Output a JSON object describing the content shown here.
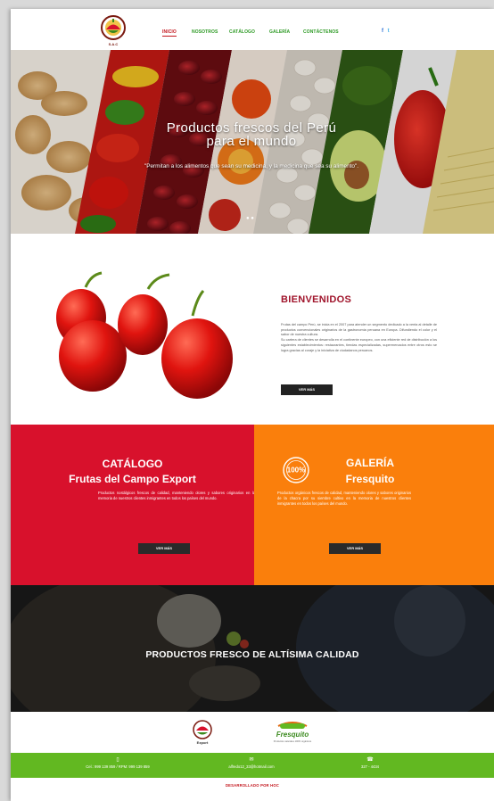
{
  "header": {
    "logo_text": "Frutas del Campo Perú",
    "logo_sub": "S.A.C",
    "nav": [
      "INICIO",
      "NOSOTROS",
      "CATÁLOGO",
      "GALERÍA",
      "CONTÁCTENOS"
    ],
    "active_nav": "INICIO",
    "social": [
      "f",
      "t"
    ]
  },
  "hero": {
    "title_line1": "Productos frescos del Perú",
    "title_line2": "para el mundo",
    "quote": "\"Permitan a los alimentos que sean su medicina, y la medicina que sea su alimento\".",
    "dots": "● ●"
  },
  "welcome": {
    "title": "BIENVENIDOS",
    "paragraph1": "Frutas del campo Perú, se inicia en el 2007 para atender un segmento dedicado a la venta al detalle de productos convencionales originarios de la gastronomía peruana en Europa. Difundiendo el color y el sabor de nuestra cultura.",
    "paragraph2": "Su cartera de clientes se desarrolla en el continente europeo, con una eficiente red de distribución a los siguientes establecimientos: restaurantes, tiendas especializadas, supermercados entre otros esto se logra gracias al coraje y la iniciativa de ciudadanos peruanos.",
    "button": "VER MÁS"
  },
  "catalog": {
    "title": "CATÁLOGO",
    "subtitle": "Frutas del Campo Export",
    "body": "Productos nostálgicos frescos de calidad, manteniendo olores y sabores originarios en la memoria de nuestros clientes inmigrantes en todos los países del mundo.",
    "button": "VER MÁS"
  },
  "gallery": {
    "title": "GALERÍA",
    "subtitle": "Fresquito",
    "badge": "100%",
    "body": "Productos orgánicos frescos de calidad, manteniendo olores y sabores originarios de la chacra por su siembre cultivo en la memoria de nuestros clientes inmigrantes en todos los países del mundo.",
    "button": "VER MÁS"
  },
  "quality": {
    "title": "PRODUCTOS FRESCO DE ALTÍSIMA CALIDAD"
  },
  "partners": {
    "logo1_caption": "Export",
    "logo2_name": "Fresquito",
    "logo2_caption": "Productos naturales 100% orgánicos"
  },
  "contact": {
    "phone": "Cel.: 999 139 859 / RPM: 999 139 859",
    "email": "alfredo12_33@hotmail.com",
    "landline": "327 - 4434"
  },
  "footer": {
    "developer": "DESARROLLADO POR HOC"
  },
  "colors": {
    "red": "#d8112c",
    "orange": "#fa7f0c",
    "green": "#62b821",
    "dark": "#1b1b1b"
  }
}
